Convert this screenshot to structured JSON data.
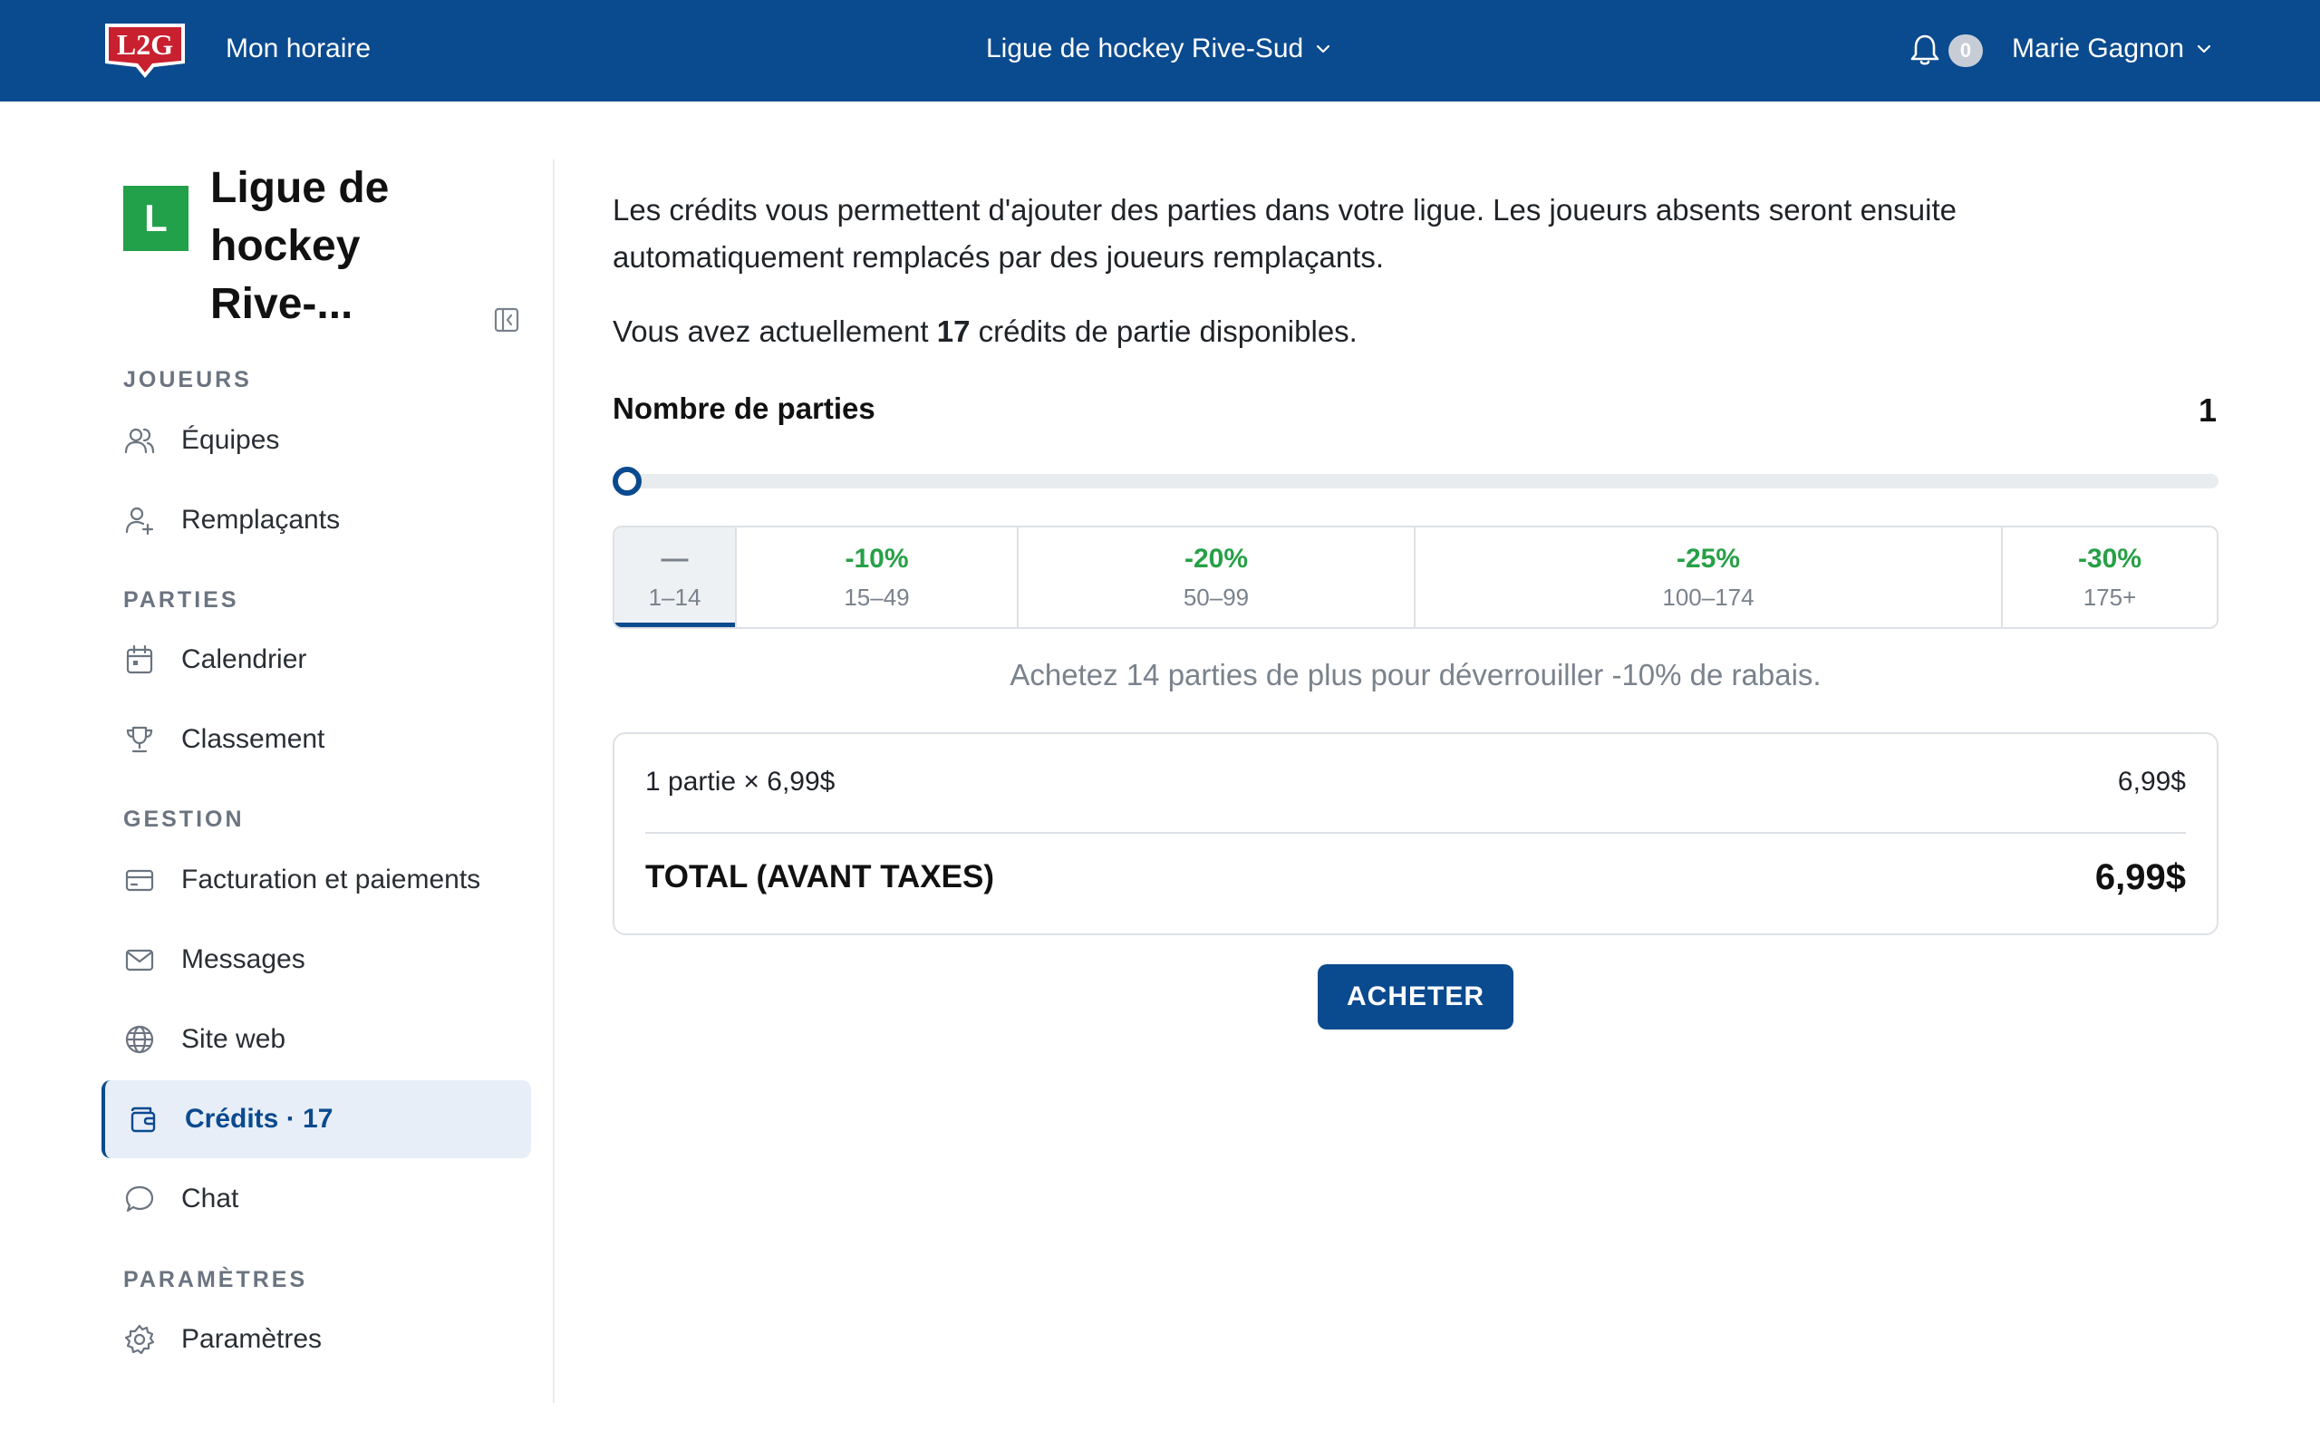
{
  "topbar": {
    "logo_text": "L2G",
    "schedule_link": "Mon horaire",
    "league_switch": "Ligue de hockey Rive-Sud",
    "notification_count": "0",
    "user_name": "Marie Gagnon"
  },
  "sidebar": {
    "league_initial": "L",
    "league_name": "Ligue de hockey Rive-...",
    "sections": {
      "players": "JOUEURS",
      "games": "PARTIES",
      "management": "GESTION",
      "settings": "PARAMÈTRES"
    },
    "items": {
      "teams": "Équipes",
      "substitutes": "Remplaçants",
      "calendar": "Calendrier",
      "standings": "Classement",
      "billing": "Facturation et paiements",
      "messages": "Messages",
      "website": "Site web",
      "credits": "Crédits · 17",
      "chat": "Chat",
      "settings": "Paramètres"
    }
  },
  "main": {
    "intro": "Les crédits vous permettent d'ajouter des parties dans votre ligue. Les joueurs absents seront ensuite automatiquement remplacés par des joueurs remplaçants.",
    "available_prefix": "Vous avez actuellement ",
    "available_count": "17",
    "available_suffix": " crédits de partie disponibles.",
    "count_label": "Nombre de parties",
    "count_value": "1",
    "slider_fraction": 0,
    "tiers": [
      {
        "discount": "—",
        "range": "1–14",
        "selected": true
      },
      {
        "discount": "-10%",
        "range": "15–49",
        "selected": false
      },
      {
        "discount": "-20%",
        "range": "50–99",
        "selected": false
      },
      {
        "discount": "-25%",
        "range": "100–174",
        "selected": false
      },
      {
        "discount": "-30%",
        "range": "175+",
        "selected": false
      }
    ],
    "hint": "Achetez 14 parties de plus pour déverrouiller -10% de rabais.",
    "summary": {
      "line_label": "1 partie × 6,99$",
      "line_amount": "6,99$",
      "total_label": "TOTAL (AVANT TAXES)",
      "total_amount": "6,99$"
    },
    "buy_label": "ACHETER"
  },
  "colors": {
    "brand": "#0a4a8f",
    "league_badge": "#22a04a",
    "discount_green": "#27a047",
    "active_bg": "#e7eef7"
  }
}
